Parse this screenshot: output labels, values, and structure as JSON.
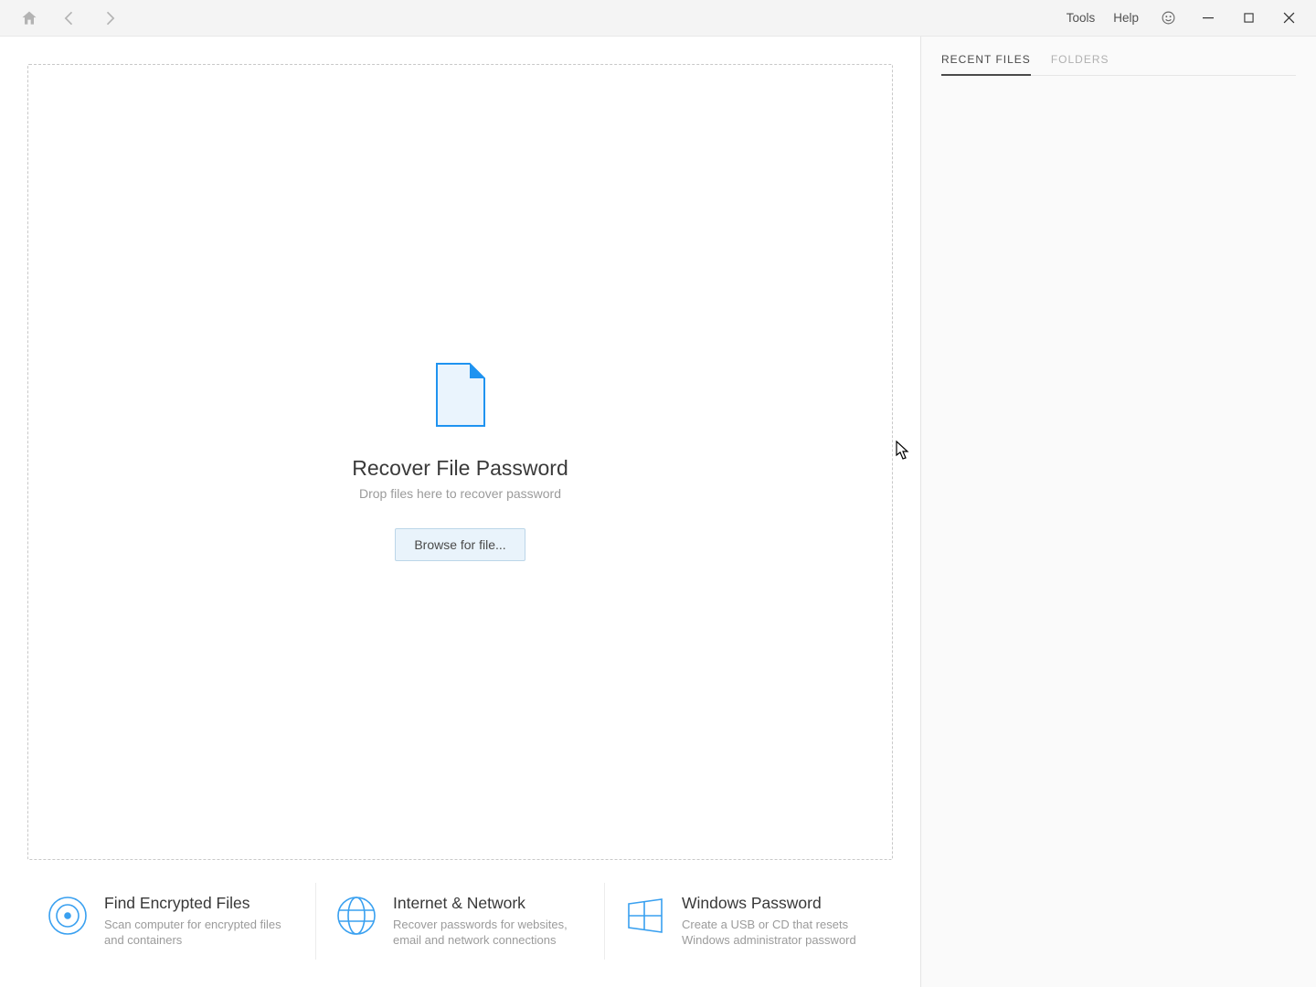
{
  "toolbar": {
    "menus": {
      "tools": "Tools",
      "help": "Help"
    }
  },
  "drop": {
    "title": "Recover File Password",
    "subtitle": "Drop files here to recover password",
    "browse": "Browse for file..."
  },
  "cards": [
    {
      "title": "Find Encrypted Files",
      "subtitle": "Scan computer for encrypted files and containers"
    },
    {
      "title": "Internet & Network",
      "subtitle": "Recover passwords for websites, email and network connections"
    },
    {
      "title": "Windows Password",
      "subtitle": "Create a USB or CD that resets Windows administrator password"
    }
  ],
  "sidebar": {
    "tabs": {
      "recent": "RECENT FILES",
      "folders": "FOLDERS"
    }
  },
  "colors": {
    "accent": "#1f93f0"
  }
}
